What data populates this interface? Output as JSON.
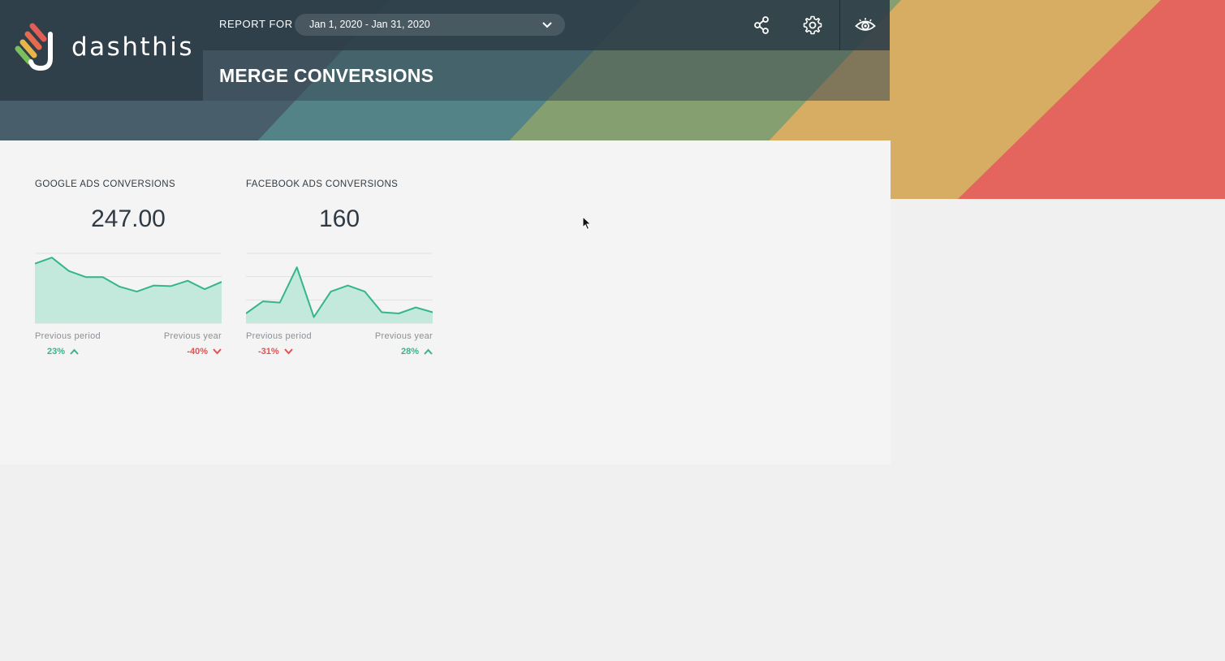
{
  "brand": {
    "name": "dashthis"
  },
  "header": {
    "report_for_label": "REPORT FOR",
    "date_range": "Jan 1, 2020 - Jan 31, 2020",
    "title": "MERGE CONVERSIONS",
    "icons": [
      "share-icon",
      "gear-icon",
      "eye-icon"
    ]
  },
  "colors": {
    "positive": "#35b58b",
    "negative": "#e05252",
    "spark_fill": "#c3e9dc",
    "spark_line": "#35b58b"
  },
  "widgets": [
    {
      "title": "GOOGLE ADS CONVERSIONS",
      "value": "247.00",
      "previous_period_label": "Previous period",
      "previous_period_change": "23%",
      "previous_period_direction": "up",
      "previous_year_label": "Previous year",
      "previous_year_change": "-40%",
      "previous_year_direction": "down"
    },
    {
      "title": "FACEBOOK ADS CONVERSIONS",
      "value": "160",
      "previous_period_label": "Previous period",
      "previous_period_change": "-31%",
      "previous_period_direction": "down",
      "previous_year_label": "Previous year",
      "previous_year_change": "28%",
      "previous_year_direction": "up"
    }
  ],
  "chart_data": [
    {
      "type": "area",
      "series": [
        {
          "values": [
            9.8,
            10.8,
            8.6,
            7.6,
            7.6,
            6.0,
            5.2,
            6.2,
            6.1,
            7.0,
            5.6,
            6.8
          ]
        }
      ],
      "ylim": [
        0,
        11.5
      ],
      "grid": true
    },
    {
      "type": "area",
      "series": [
        {
          "values": [
            1.6,
            3.6,
            3.4,
            9.2,
            1.0,
            5.2,
            6.2,
            5.2,
            1.8,
            1.6,
            2.6,
            1.8
          ]
        }
      ],
      "ylim": [
        0,
        11.5
      ],
      "grid": true
    }
  ]
}
